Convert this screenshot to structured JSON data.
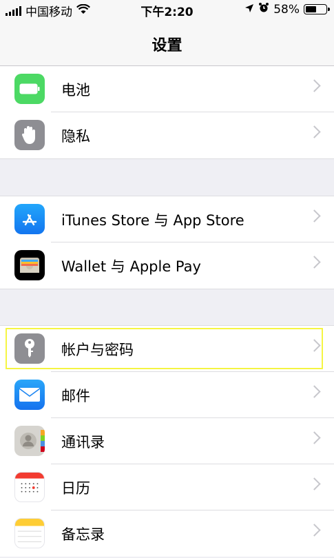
{
  "status_bar": {
    "carrier": "中国移动",
    "time": "下午2:20",
    "battery_percent": "58%",
    "battery_level": 0.58,
    "icons": [
      "signal-icon",
      "wifi-icon",
      "location-arrow-icon",
      "alarm-icon",
      "battery-icon"
    ]
  },
  "nav": {
    "title": "设置"
  },
  "groups": [
    {
      "items": [
        {
          "label": "电池",
          "icon": "battery-icon",
          "color": "#4cd964"
        },
        {
          "label": "隐私",
          "icon": "hand-icon",
          "color": "#8e8e93"
        }
      ]
    },
    {
      "items": [
        {
          "label": "iTunes Store 与 App Store",
          "icon": "app-store-icon",
          "color": "#1a8cf6"
        },
        {
          "label": "Wallet 与 Apple Pay",
          "icon": "wallet-icon",
          "color": "#000000"
        }
      ]
    },
    {
      "items": [
        {
          "label": "帐户与密码",
          "icon": "key-icon",
          "color": "#8e8e93",
          "highlighted": true
        },
        {
          "label": "邮件",
          "icon": "mail-icon",
          "color": "#1e90f5"
        },
        {
          "label": "通讯录",
          "icon": "contacts-icon",
          "color": "#d6d4cf"
        },
        {
          "label": "日历",
          "icon": "calendar-icon",
          "color": "#ffffff"
        },
        {
          "label": "备忘录",
          "icon": "notes-icon",
          "color": "#ffffff"
        }
      ]
    }
  ],
  "colors": {
    "background": "#efeff4",
    "highlight": "#f5f542",
    "chevron": "#c7c7cc"
  }
}
